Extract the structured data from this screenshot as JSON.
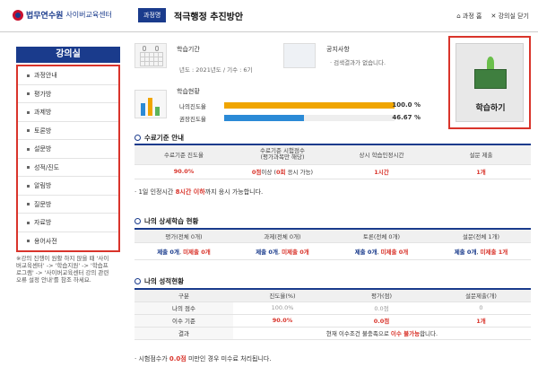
{
  "header": {
    "logo_main": "법무연수원",
    "logo_sub": "사이버교육센터",
    "course_badge": "과정명",
    "course_title": "적극행정 추진방안",
    "link_home": "과정 홈",
    "link_close": "강의실 닫기"
  },
  "sidebar": {
    "title": "강의실",
    "items": [
      "과정안내",
      "평가방",
      "과제방",
      "토론방",
      "설문방",
      "성적/진도",
      "알림방",
      "질문방",
      "자료방",
      "용어사전"
    ],
    "note": "※강의 진행이 원활 하지 않을 때 '사이버교육센터' -> '학습지원' -> '학습프로그램' -> '사이버교육센터 강의 관련 오류 설정 안내'를 참조 하세요."
  },
  "info": {
    "period_title": "학습기간",
    "period_value": "년도 : 2021년도 / 기수 : 6기",
    "notice_title": "공지사항",
    "notice_value": "· 검색결과가 없습니다.",
    "status_title": "학습현황",
    "my_progress_label": "나의진도율",
    "my_progress": "100.0 %",
    "my_progress_value": 100.0,
    "rec_progress_label": "권장진도율",
    "rec_progress": "46.67 %",
    "rec_progress_value": 46.67
  },
  "study_button": "학습하기",
  "completion": {
    "title": "수료기준 안내",
    "headers": [
      "수료기준 진도율",
      "수료기준 시험점수\n(평가과목만 해당)",
      "상시 학습인정시간",
      "설문 제출"
    ],
    "values": [
      "90.0%",
      "0점",
      "이상 (",
      "0회",
      " 응시 가능)",
      "1시간",
      "1개"
    ],
    "note_pre": "· 1일 인정시간 ",
    "note_red": "8시간 이하",
    "note_post": "까지 응시 가능합니다."
  },
  "detail": {
    "title": "나의 상세학습 현황",
    "headers": [
      "평가(전체 0개)",
      "과제(전체 0개)",
      "토론(전체 0개)",
      "설문(전체 1개)"
    ],
    "cells": [
      {
        "a": "제출 0개",
        "b": "미제출 0개"
      },
      {
        "a": "제출 0개",
        "b": "미제출 0개"
      },
      {
        "a": "제출 0개",
        "b": "미제출 0개"
      },
      {
        "a": "제출 0개",
        "b": "미제출 1개"
      }
    ]
  },
  "grades": {
    "title": "나의 성적현황",
    "headers": [
      "구분",
      "진도율(%)",
      "평가(점)",
      "설문제출(개)"
    ],
    "rows": [
      [
        "나의 점수",
        "100.0%",
        "0.0점",
        "0"
      ],
      [
        "이수 기준",
        "90.0%",
        "0.0점",
        "1개"
      ]
    ],
    "result_label": "결과",
    "result_pre": "현재 이수조건 불충족으로 ",
    "result_red": "이수 불가능",
    "result_post": "합니다.",
    "note_pre": "· 시험점수가 ",
    "note_red": "0.0점",
    "note_post": " 미만인 경우 미수료 처리됩니다."
  },
  "colors": {
    "brand": "#1a3b8c",
    "highlight": "#d9342b",
    "my_bar": "#f0a500",
    "rec_bar": "#2b8ad6"
  }
}
